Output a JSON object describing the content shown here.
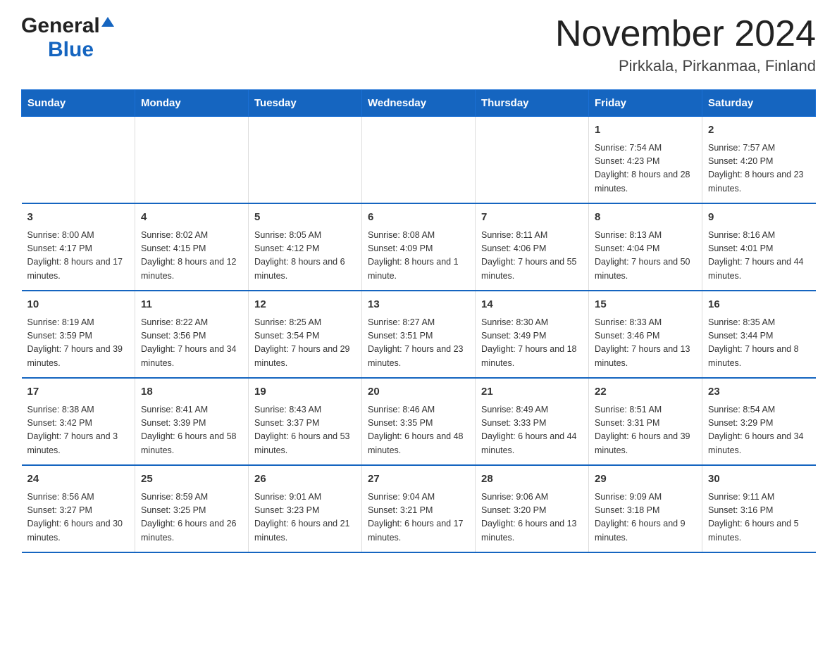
{
  "logo": {
    "general": "General",
    "blue": "Blue"
  },
  "title": {
    "month_year": "November 2024",
    "location": "Pirkkala, Pirkanmaa, Finland"
  },
  "weekdays": [
    "Sunday",
    "Monday",
    "Tuesday",
    "Wednesday",
    "Thursday",
    "Friday",
    "Saturday"
  ],
  "weeks": [
    {
      "days": [
        {
          "number": "",
          "info": ""
        },
        {
          "number": "",
          "info": ""
        },
        {
          "number": "",
          "info": ""
        },
        {
          "number": "",
          "info": ""
        },
        {
          "number": "",
          "info": ""
        },
        {
          "number": "1",
          "info": "Sunrise: 7:54 AM\nSunset: 4:23 PM\nDaylight: 8 hours and 28 minutes."
        },
        {
          "number": "2",
          "info": "Sunrise: 7:57 AM\nSunset: 4:20 PM\nDaylight: 8 hours and 23 minutes."
        }
      ]
    },
    {
      "days": [
        {
          "number": "3",
          "info": "Sunrise: 8:00 AM\nSunset: 4:17 PM\nDaylight: 8 hours and 17 minutes."
        },
        {
          "number": "4",
          "info": "Sunrise: 8:02 AM\nSunset: 4:15 PM\nDaylight: 8 hours and 12 minutes."
        },
        {
          "number": "5",
          "info": "Sunrise: 8:05 AM\nSunset: 4:12 PM\nDaylight: 8 hours and 6 minutes."
        },
        {
          "number": "6",
          "info": "Sunrise: 8:08 AM\nSunset: 4:09 PM\nDaylight: 8 hours and 1 minute."
        },
        {
          "number": "7",
          "info": "Sunrise: 8:11 AM\nSunset: 4:06 PM\nDaylight: 7 hours and 55 minutes."
        },
        {
          "number": "8",
          "info": "Sunrise: 8:13 AM\nSunset: 4:04 PM\nDaylight: 7 hours and 50 minutes."
        },
        {
          "number": "9",
          "info": "Sunrise: 8:16 AM\nSunset: 4:01 PM\nDaylight: 7 hours and 44 minutes."
        }
      ]
    },
    {
      "days": [
        {
          "number": "10",
          "info": "Sunrise: 8:19 AM\nSunset: 3:59 PM\nDaylight: 7 hours and 39 minutes."
        },
        {
          "number": "11",
          "info": "Sunrise: 8:22 AM\nSunset: 3:56 PM\nDaylight: 7 hours and 34 minutes."
        },
        {
          "number": "12",
          "info": "Sunrise: 8:25 AM\nSunset: 3:54 PM\nDaylight: 7 hours and 29 minutes."
        },
        {
          "number": "13",
          "info": "Sunrise: 8:27 AM\nSunset: 3:51 PM\nDaylight: 7 hours and 23 minutes."
        },
        {
          "number": "14",
          "info": "Sunrise: 8:30 AM\nSunset: 3:49 PM\nDaylight: 7 hours and 18 minutes."
        },
        {
          "number": "15",
          "info": "Sunrise: 8:33 AM\nSunset: 3:46 PM\nDaylight: 7 hours and 13 minutes."
        },
        {
          "number": "16",
          "info": "Sunrise: 8:35 AM\nSunset: 3:44 PM\nDaylight: 7 hours and 8 minutes."
        }
      ]
    },
    {
      "days": [
        {
          "number": "17",
          "info": "Sunrise: 8:38 AM\nSunset: 3:42 PM\nDaylight: 7 hours and 3 minutes."
        },
        {
          "number": "18",
          "info": "Sunrise: 8:41 AM\nSunset: 3:39 PM\nDaylight: 6 hours and 58 minutes."
        },
        {
          "number": "19",
          "info": "Sunrise: 8:43 AM\nSunset: 3:37 PM\nDaylight: 6 hours and 53 minutes."
        },
        {
          "number": "20",
          "info": "Sunrise: 8:46 AM\nSunset: 3:35 PM\nDaylight: 6 hours and 48 minutes."
        },
        {
          "number": "21",
          "info": "Sunrise: 8:49 AM\nSunset: 3:33 PM\nDaylight: 6 hours and 44 minutes."
        },
        {
          "number": "22",
          "info": "Sunrise: 8:51 AM\nSunset: 3:31 PM\nDaylight: 6 hours and 39 minutes."
        },
        {
          "number": "23",
          "info": "Sunrise: 8:54 AM\nSunset: 3:29 PM\nDaylight: 6 hours and 34 minutes."
        }
      ]
    },
    {
      "days": [
        {
          "number": "24",
          "info": "Sunrise: 8:56 AM\nSunset: 3:27 PM\nDaylight: 6 hours and 30 minutes."
        },
        {
          "number": "25",
          "info": "Sunrise: 8:59 AM\nSunset: 3:25 PM\nDaylight: 6 hours and 26 minutes."
        },
        {
          "number": "26",
          "info": "Sunrise: 9:01 AM\nSunset: 3:23 PM\nDaylight: 6 hours and 21 minutes."
        },
        {
          "number": "27",
          "info": "Sunrise: 9:04 AM\nSunset: 3:21 PM\nDaylight: 6 hours and 17 minutes."
        },
        {
          "number": "28",
          "info": "Sunrise: 9:06 AM\nSunset: 3:20 PM\nDaylight: 6 hours and 13 minutes."
        },
        {
          "number": "29",
          "info": "Sunrise: 9:09 AM\nSunset: 3:18 PM\nDaylight: 6 hours and 9 minutes."
        },
        {
          "number": "30",
          "info": "Sunrise: 9:11 AM\nSunset: 3:16 PM\nDaylight: 6 hours and 5 minutes."
        }
      ]
    }
  ]
}
